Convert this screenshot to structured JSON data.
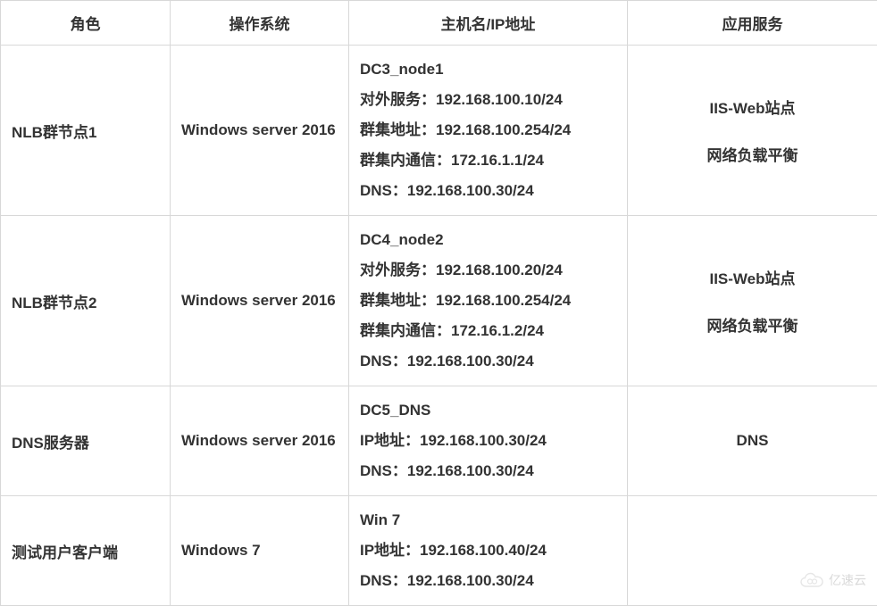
{
  "table": {
    "headers": {
      "role": "角色",
      "os": "操作系统",
      "host": "主机名/IP地址",
      "service": "应用服务"
    },
    "rows": [
      {
        "role": "NLB群节点1",
        "os": "Windows server 2016",
        "host": "DC3_node1\n对外服务：192.168.100.10/24\n群集地址：192.168.100.254/24\n群集内通信：172.16.1.1/24\nDNS：192.168.100.30/24",
        "service_line1": "IIS-Web站点",
        "service_line2": "网络负载平衡"
      },
      {
        "role": "NLB群节点2",
        "os": "Windows server 2016",
        "host": "DC4_node2\n对外服务：192.168.100.20/24\n群集地址：192.168.100.254/24\n群集内通信：172.16.1.2/24\nDNS：192.168.100.30/24",
        "service_line1": "IIS-Web站点",
        "service_line2": "网络负载平衡"
      },
      {
        "role": "DNS服务器",
        "os": "Windows server 2016",
        "host": "DC5_DNS\nIP地址：192.168.100.30/24\nDNS：192.168.100.30/24",
        "service_line1": "DNS",
        "service_line2": ""
      },
      {
        "role": "测试用户客户端",
        "os": "Windows 7",
        "host": "Win 7\nIP地址：192.168.100.40/24\nDNS：192.168.100.30/24",
        "service_line1": "",
        "service_line2": ""
      }
    ]
  },
  "watermark": "亿速云"
}
